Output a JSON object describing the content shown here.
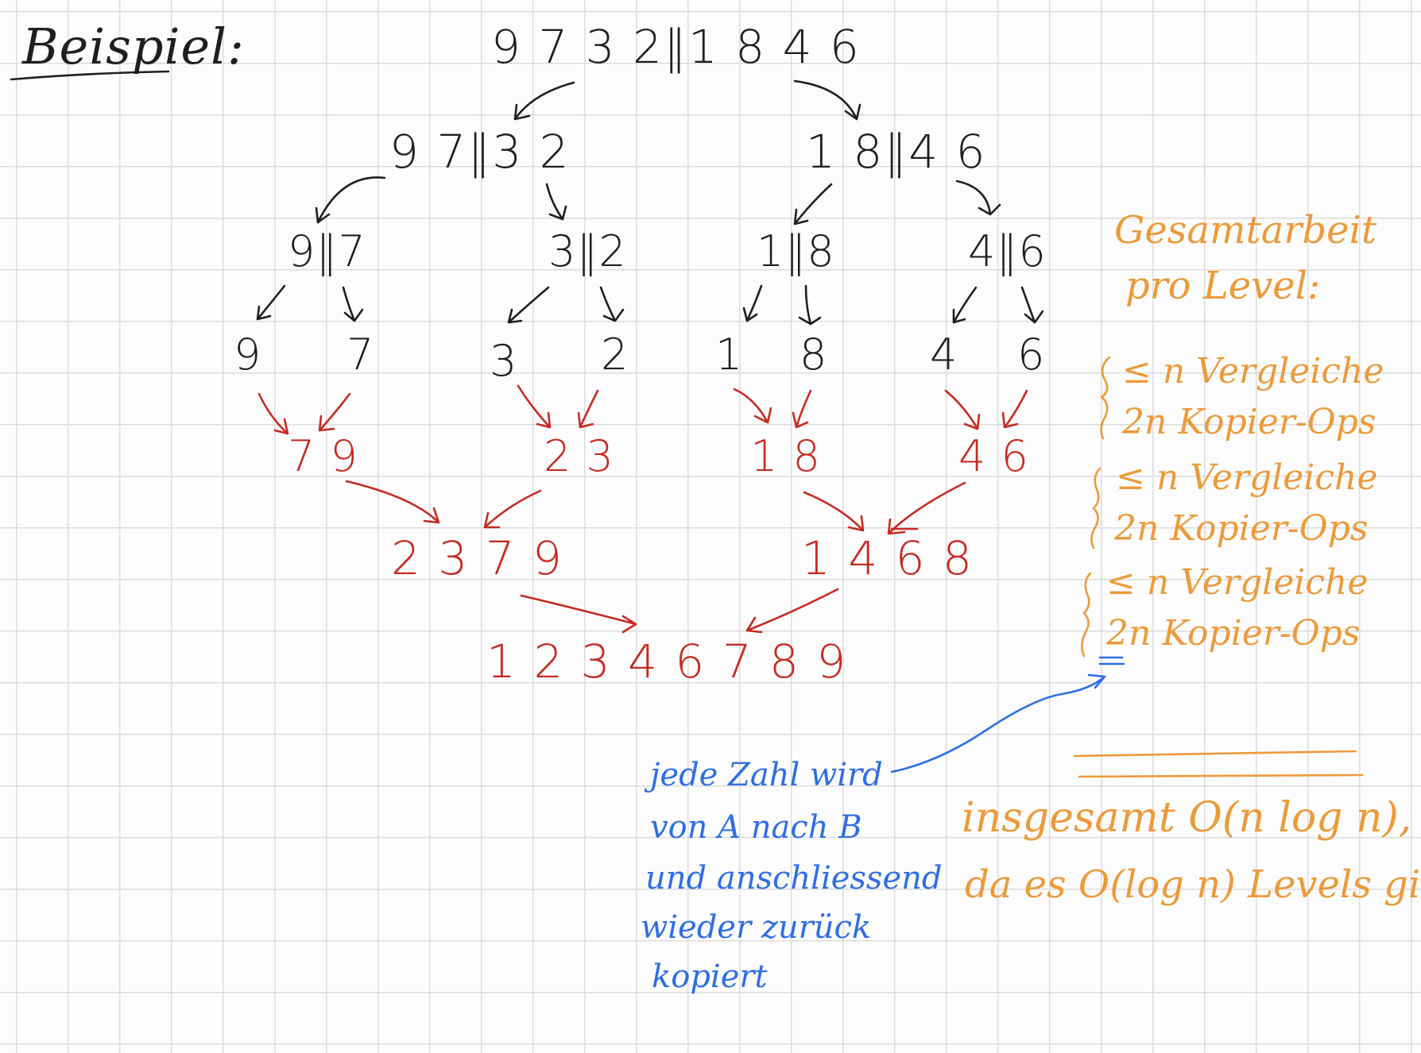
{
  "heading": "Beispiel:",
  "split": {
    "root": "9 7 3 2‖1 8 4 6",
    "level1": [
      "9 7‖3 2",
      "1 8‖4 6"
    ],
    "level2": [
      "9‖7",
      "3‖2",
      "1‖8",
      "4‖6"
    ],
    "leaves": [
      "9",
      "7",
      "3",
      "2",
      "1",
      "8",
      "4",
      "6"
    ]
  },
  "merge": {
    "pairs": [
      "7 9",
      "2 3",
      "1 8",
      "4 6"
    ],
    "quads": [
      "2 3 7 9",
      "1 4 6 8"
    ],
    "result": "1 2 3 4 6 7 8 9"
  },
  "side_notes": {
    "title_line1": "Gesamtarbeit",
    "title_line2": "pro Level:",
    "levels": [
      {
        "compare": "≤ n Vergleiche",
        "copy": "2n Kopier-Ops"
      },
      {
        "compare": "≤ n Vergleiche",
        "copy": "2n Kopier-Ops"
      },
      {
        "compare": "≤ n Vergleiche",
        "copy": "2n Kopier-Ops"
      }
    ],
    "equals": "=",
    "total_line1": "insgesamt O(n log n),",
    "total_line2": "da es O(log n) Levels gibt"
  },
  "blue_note": [
    "jede Zahl wird",
    "von A nach B",
    "und anschliessend",
    "wieder zurück",
    "kopiert"
  ],
  "colors": {
    "black": "#1f1f1f",
    "red": "#c62a22",
    "orange": "#ec9a3a",
    "blue": "#2e6ee6",
    "grid": "#dcdcdc"
  }
}
